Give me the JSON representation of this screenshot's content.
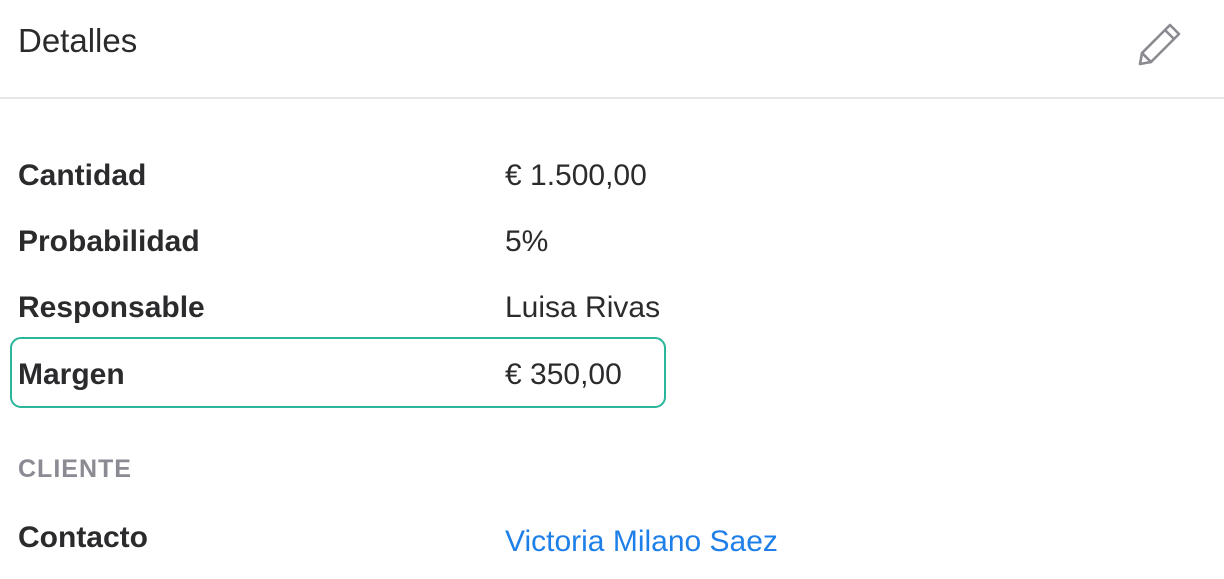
{
  "header": {
    "title": "Detalles",
    "edit_icon": "pencil-icon"
  },
  "details": [
    {
      "label": "Cantidad",
      "value": "€ 1.500,00"
    },
    {
      "label": "Probabilidad",
      "value": "5%"
    },
    {
      "label": "Responsable",
      "value": "Luisa Rivas"
    },
    {
      "label": "Margen",
      "value": "€ 350,00"
    }
  ],
  "highlight_color": "#2bb59a",
  "link_color": "#1f7fe8",
  "cliente": {
    "section_title": "CLIENTE",
    "contact_label": "Contacto",
    "contact_value": "Victoria Milano Saez"
  }
}
